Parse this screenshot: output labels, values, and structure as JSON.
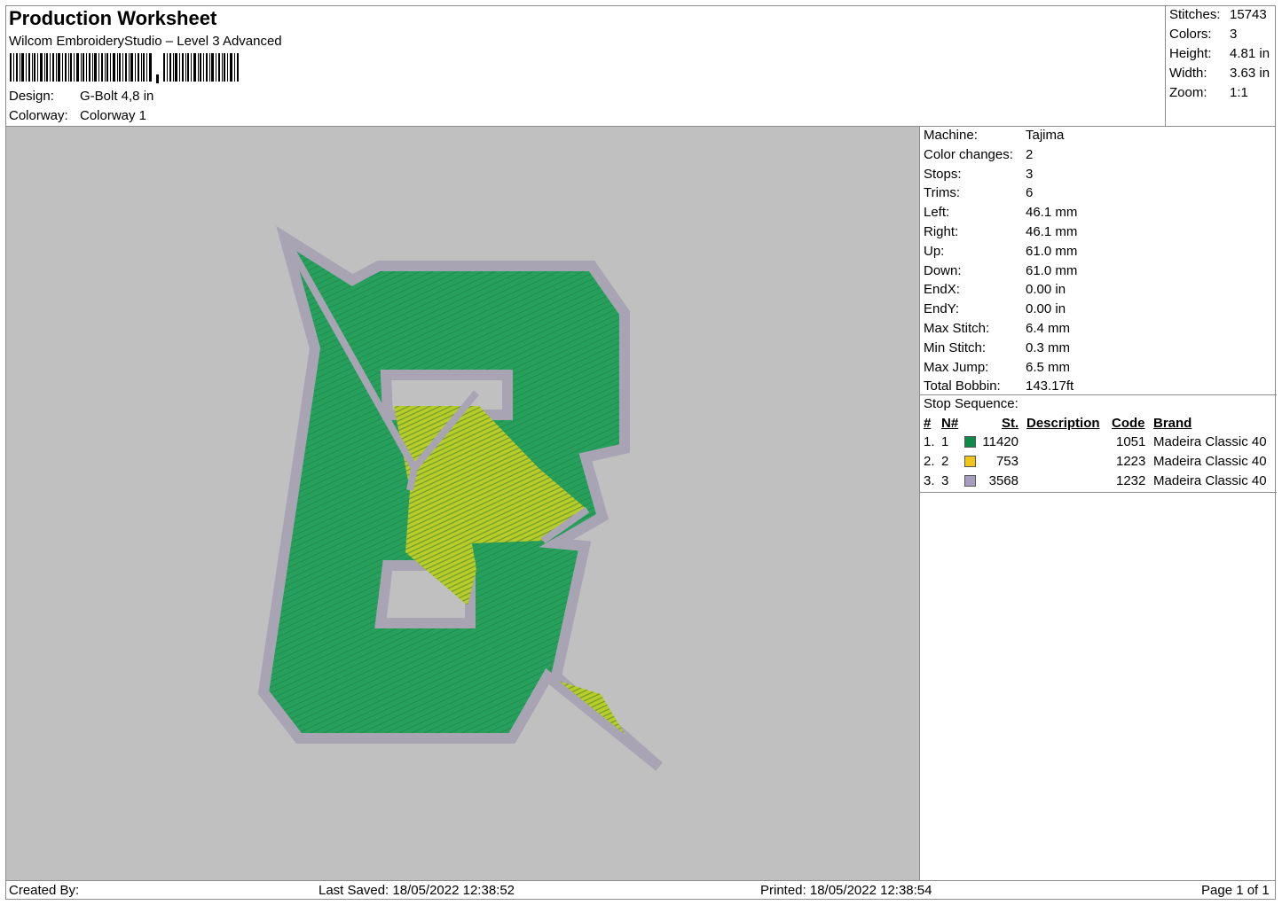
{
  "header": {
    "title": "Production Worksheet",
    "software": "Wilcom EmbroideryStudio – Level 3 Advanced",
    "design_label": "Design:",
    "design_value": "G-Bolt 4,8 in",
    "colorway_label": "Colorway:",
    "colorway_value": "Colorway 1"
  },
  "summary": {
    "stitches_label": "Stitches:",
    "stitches_value": "15743",
    "colors_label": "Colors:",
    "colors_value": "3",
    "height_label": "Height:",
    "height_value": "4.81 in",
    "width_label": "Width:",
    "width_value": "3.63 in",
    "zoom_label": "Zoom:",
    "zoom_value": "1:1"
  },
  "machine_info": [
    {
      "label": "Machine:",
      "value": "Tajima"
    },
    {
      "label": "Color changes:",
      "value": "2"
    },
    {
      "label": "Stops:",
      "value": "3"
    },
    {
      "label": "Trims:",
      "value": "6"
    },
    {
      "label": "Left:",
      "value": "46.1 mm"
    },
    {
      "label": "Right:",
      "value": "46.1 mm"
    },
    {
      "label": "Up:",
      "value": "61.0 mm"
    },
    {
      "label": "Down:",
      "value": "61.0 mm"
    },
    {
      "label": "EndX:",
      "value": "0.00 in"
    },
    {
      "label": "EndY:",
      "value": "0.00 in"
    },
    {
      "label": "Max Stitch:",
      "value": "6.4 mm"
    },
    {
      "label": "Min Stitch:",
      "value": "0.3 mm"
    },
    {
      "label": "Max Jump:",
      "value": "6.5 mm"
    },
    {
      "label": "Total Bobbin:",
      "value": "143.17ft"
    }
  ],
  "stop_sequence": {
    "title": "Stop Sequence:",
    "columns": {
      "num": "#",
      "n": "N#",
      "st": "St.",
      "description": "Description",
      "code": "Code",
      "brand": "Brand"
    },
    "rows": [
      {
        "num": "1.",
        "n": "1",
        "color": "#0e8a4a",
        "st": "11420",
        "description": "",
        "code": "1051",
        "brand": "Madeira Classic 40"
      },
      {
        "num": "2.",
        "n": "2",
        "color": "#f0c419",
        "st": "753",
        "description": "",
        "code": "1223",
        "brand": "Madeira Classic 40"
      },
      {
        "num": "3.",
        "n": "3",
        "color": "#a89cc0",
        "st": "3568",
        "description": "",
        "code": "1232",
        "brand": "Madeira Classic 40"
      }
    ]
  },
  "footer": {
    "created_by": "Created By:",
    "last_saved": "Last Saved: 18/05/2022 12:38:52",
    "printed": "Printed: 18/05/2022 12:38:54",
    "page": "Page 1 of 1"
  },
  "colors": {
    "canvas_bg": "#c0c0c0",
    "green_fill": "#27a05c",
    "yellow_fill": "#c8d420",
    "outline": "#a8a4b4"
  }
}
